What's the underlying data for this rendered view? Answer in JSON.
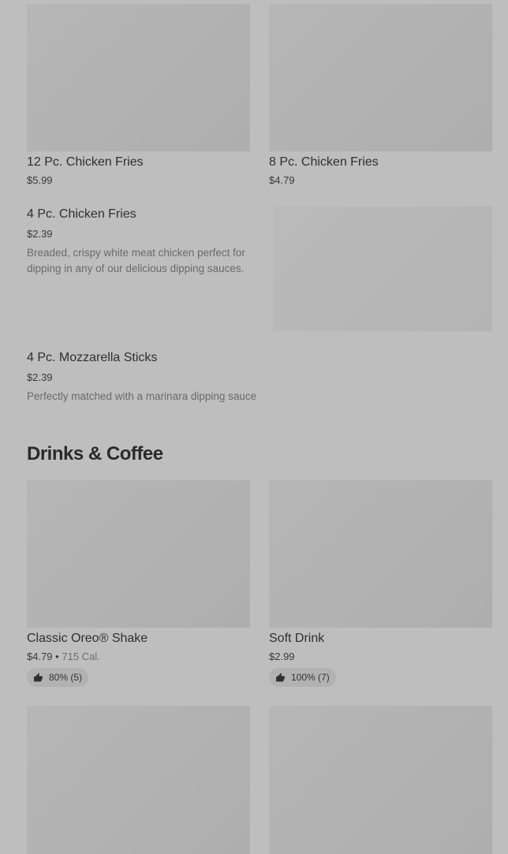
{
  "items": [
    {
      "title": "12 Pc. Chicken Fries",
      "price": "$5.99"
    },
    {
      "title": "8 Pc. Chicken Fries",
      "price": "$4.79"
    },
    {
      "title": "4 Pc. Chicken Fries",
      "price": "$2.39",
      "description": "Breaded, crispy white meat chicken perfect for dipping in any of our delicious dipping sauces."
    },
    {
      "title": "4 Pc. Mozzarella Sticks",
      "price": "$2.39",
      "description": "Perfectly matched with a marinara dipping sauce"
    }
  ],
  "section": {
    "title": "Drinks & Coffee",
    "items": [
      {
        "title": "Classic Oreo® Shake",
        "price": "$4.79",
        "separator": "•",
        "calories": "715 Cal.",
        "rating": "80% (5)",
        "rating_icon": "thumbs-up-icon"
      },
      {
        "title": "Soft Drink",
        "price": "$2.99",
        "rating": "100% (7)",
        "rating_icon": "thumbs-up-icon"
      }
    ]
  }
}
